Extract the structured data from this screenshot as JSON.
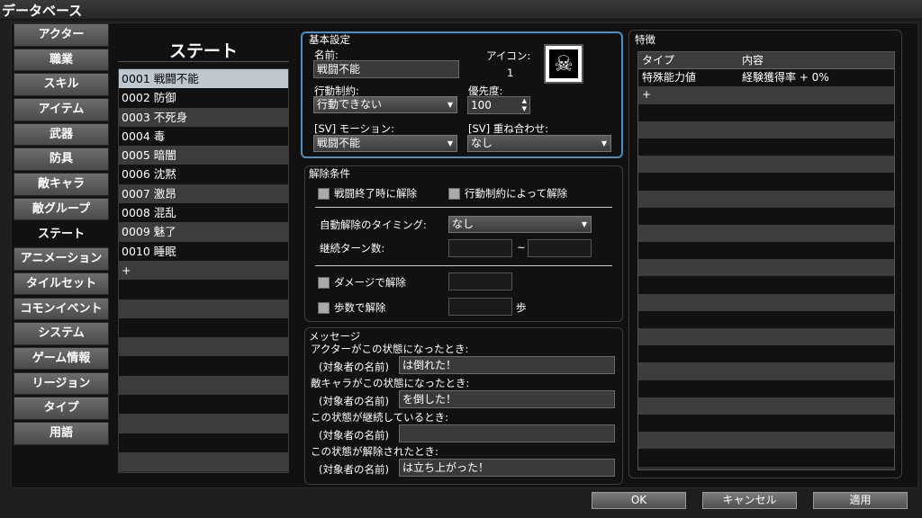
{
  "window": {
    "title": "データベース"
  },
  "categories": [
    "アクター",
    "職業",
    "スキル",
    "アイテム",
    "武器",
    "防具",
    "敵キャラ",
    "敵グループ",
    "ステート",
    "アニメーション",
    "タイルセット",
    "コモンイベント",
    "システム",
    "ゲーム情報",
    "リージョン",
    "タイプ",
    "用語"
  ],
  "selected_category": "ステート",
  "list": {
    "title": "ステート",
    "items": [
      "0001 戦闘不能",
      "0002 防御",
      "0003 不死身",
      "0004 毒",
      "0005 暗闇",
      "0006 沈黙",
      "0007 激昂",
      "0008 混乱",
      "0009 魅了",
      "0010 睡眠",
      "+"
    ],
    "selected_index": 0
  },
  "basic": {
    "section_label": "基本設定",
    "name_label": "名前:",
    "name_value": "戦闘不能",
    "icon_label": "アイコン:",
    "icon_index": "1",
    "icon_glyph": "☠",
    "restriction_label": "行動制約:",
    "restriction_value": "行動できない",
    "priority_label": "優先度:",
    "priority_value": "100",
    "motion_label": "[SV] モーション:",
    "motion_value": "戦闘不能",
    "overlay_label": "[SV] 重ね合わせ:",
    "overlay_value": "なし"
  },
  "removal": {
    "section_label": "解除条件",
    "battle_end": "戦闘終了時に解除",
    "restriction": "行動制約によって解除",
    "timing_label": "自動解除のタイミング:",
    "timing_value": "なし",
    "turns_label": "継続ターン数:",
    "tilde": "~",
    "damage": "ダメージで解除",
    "steps": "歩数で解除",
    "steps_unit": "歩"
  },
  "messages": {
    "section_label": "メッセージ",
    "prefix": "(対象者の名前)",
    "items": [
      {
        "label": "アクターがこの状態になったとき:",
        "value": "は倒れた！"
      },
      {
        "label": "敵キャラがこの状態になったとき:",
        "value": "を倒した！"
      },
      {
        "label": "この状態が継続しているとき:",
        "value": ""
      },
      {
        "label": "この状態が解除されたとき:",
        "value": "は立ち上がった！"
      }
    ]
  },
  "traits": {
    "section_label": "特徴",
    "col_type": "タイプ",
    "col_content": "内容",
    "rows": [
      {
        "type": "特殊能力値",
        "content": "経験獲得率 + 0%"
      }
    ],
    "add": "+"
  },
  "buttons": {
    "ok": "OK",
    "cancel": "キャンセル",
    "apply": "適用"
  },
  "colors": {
    "accent_border": "#4a90c8",
    "selected_row": "#bfc7cf"
  }
}
